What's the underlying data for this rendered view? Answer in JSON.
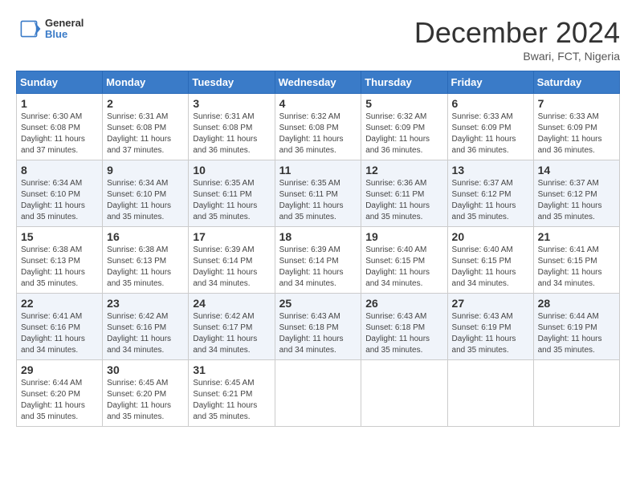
{
  "header": {
    "logo_line1": "General",
    "logo_line2": "Blue",
    "month_title": "December 2024",
    "location": "Bwari, FCT, Nigeria"
  },
  "weekdays": [
    "Sunday",
    "Monday",
    "Tuesday",
    "Wednesday",
    "Thursday",
    "Friday",
    "Saturday"
  ],
  "weeks": [
    [
      {
        "day": "1",
        "sunrise": "6:30 AM",
        "sunset": "6:08 PM",
        "daylight": "11 hours and 37 minutes."
      },
      {
        "day": "2",
        "sunrise": "6:31 AM",
        "sunset": "6:08 PM",
        "daylight": "11 hours and 37 minutes."
      },
      {
        "day": "3",
        "sunrise": "6:31 AM",
        "sunset": "6:08 PM",
        "daylight": "11 hours and 36 minutes."
      },
      {
        "day": "4",
        "sunrise": "6:32 AM",
        "sunset": "6:08 PM",
        "daylight": "11 hours and 36 minutes."
      },
      {
        "day": "5",
        "sunrise": "6:32 AM",
        "sunset": "6:09 PM",
        "daylight": "11 hours and 36 minutes."
      },
      {
        "day": "6",
        "sunrise": "6:33 AM",
        "sunset": "6:09 PM",
        "daylight": "11 hours and 36 minutes."
      },
      {
        "day": "7",
        "sunrise": "6:33 AM",
        "sunset": "6:09 PM",
        "daylight": "11 hours and 36 minutes."
      }
    ],
    [
      {
        "day": "8",
        "sunrise": "6:34 AM",
        "sunset": "6:10 PM",
        "daylight": "11 hours and 35 minutes."
      },
      {
        "day": "9",
        "sunrise": "6:34 AM",
        "sunset": "6:10 PM",
        "daylight": "11 hours and 35 minutes."
      },
      {
        "day": "10",
        "sunrise": "6:35 AM",
        "sunset": "6:11 PM",
        "daylight": "11 hours and 35 minutes."
      },
      {
        "day": "11",
        "sunrise": "6:35 AM",
        "sunset": "6:11 PM",
        "daylight": "11 hours and 35 minutes."
      },
      {
        "day": "12",
        "sunrise": "6:36 AM",
        "sunset": "6:11 PM",
        "daylight": "11 hours and 35 minutes."
      },
      {
        "day": "13",
        "sunrise": "6:37 AM",
        "sunset": "6:12 PM",
        "daylight": "11 hours and 35 minutes."
      },
      {
        "day": "14",
        "sunrise": "6:37 AM",
        "sunset": "6:12 PM",
        "daylight": "11 hours and 35 minutes."
      }
    ],
    [
      {
        "day": "15",
        "sunrise": "6:38 AM",
        "sunset": "6:13 PM",
        "daylight": "11 hours and 35 minutes."
      },
      {
        "day": "16",
        "sunrise": "6:38 AM",
        "sunset": "6:13 PM",
        "daylight": "11 hours and 35 minutes."
      },
      {
        "day": "17",
        "sunrise": "6:39 AM",
        "sunset": "6:14 PM",
        "daylight": "11 hours and 34 minutes."
      },
      {
        "day": "18",
        "sunrise": "6:39 AM",
        "sunset": "6:14 PM",
        "daylight": "11 hours and 34 minutes."
      },
      {
        "day": "19",
        "sunrise": "6:40 AM",
        "sunset": "6:15 PM",
        "daylight": "11 hours and 34 minutes."
      },
      {
        "day": "20",
        "sunrise": "6:40 AM",
        "sunset": "6:15 PM",
        "daylight": "11 hours and 34 minutes."
      },
      {
        "day": "21",
        "sunrise": "6:41 AM",
        "sunset": "6:15 PM",
        "daylight": "11 hours and 34 minutes."
      }
    ],
    [
      {
        "day": "22",
        "sunrise": "6:41 AM",
        "sunset": "6:16 PM",
        "daylight": "11 hours and 34 minutes."
      },
      {
        "day": "23",
        "sunrise": "6:42 AM",
        "sunset": "6:16 PM",
        "daylight": "11 hours and 34 minutes."
      },
      {
        "day": "24",
        "sunrise": "6:42 AM",
        "sunset": "6:17 PM",
        "daylight": "11 hours and 34 minutes."
      },
      {
        "day": "25",
        "sunrise": "6:43 AM",
        "sunset": "6:18 PM",
        "daylight": "11 hours and 34 minutes."
      },
      {
        "day": "26",
        "sunrise": "6:43 AM",
        "sunset": "6:18 PM",
        "daylight": "11 hours and 35 minutes."
      },
      {
        "day": "27",
        "sunrise": "6:43 AM",
        "sunset": "6:19 PM",
        "daylight": "11 hours and 35 minutes."
      },
      {
        "day": "28",
        "sunrise": "6:44 AM",
        "sunset": "6:19 PM",
        "daylight": "11 hours and 35 minutes."
      }
    ],
    [
      {
        "day": "29",
        "sunrise": "6:44 AM",
        "sunset": "6:20 PM",
        "daylight": "11 hours and 35 minutes."
      },
      {
        "day": "30",
        "sunrise": "6:45 AM",
        "sunset": "6:20 PM",
        "daylight": "11 hours and 35 minutes."
      },
      {
        "day": "31",
        "sunrise": "6:45 AM",
        "sunset": "6:21 PM",
        "daylight": "11 hours and 35 minutes."
      },
      null,
      null,
      null,
      null
    ]
  ],
  "labels": {
    "sunrise": "Sunrise: ",
    "sunset": "Sunset: ",
    "daylight": "Daylight: "
  }
}
